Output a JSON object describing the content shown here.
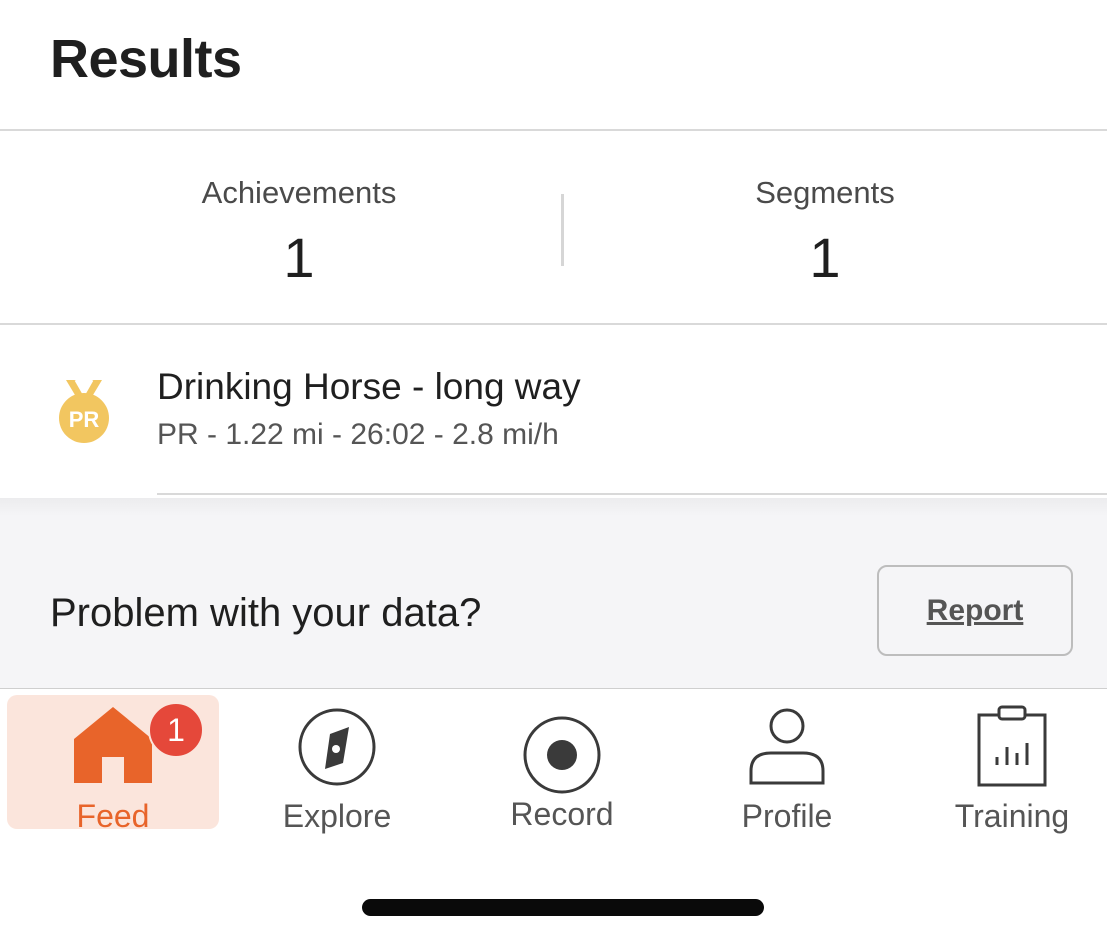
{
  "header": {
    "title": "Results"
  },
  "stats": {
    "achievements": {
      "label": "Achievements",
      "value": "1"
    },
    "segments": {
      "label": "Segments",
      "value": "1"
    }
  },
  "segment": {
    "icon": "pr-medal-icon",
    "icon_text": "PR",
    "name": "Drinking Horse - long way",
    "meta": "PR - 1.22 mi - 26:02 - 2.8 mi/h"
  },
  "problem": {
    "text": "Problem with your data?",
    "report_label": "Report"
  },
  "tabbar": {
    "tabs": [
      {
        "label": "Feed",
        "icon": "home-icon",
        "active": true,
        "badge": "1"
      },
      {
        "label": "Explore",
        "icon": "compass-icon"
      },
      {
        "label": "Record",
        "icon": "record-icon"
      },
      {
        "label": "Profile",
        "icon": "person-icon"
      },
      {
        "label": "Training",
        "icon": "clipboard-chart-icon"
      }
    ]
  },
  "colors": {
    "accent": "#e8642a",
    "active_tab_bg": "#fbe5dc",
    "badge": "#e5483a",
    "medal": "#f2c660"
  }
}
